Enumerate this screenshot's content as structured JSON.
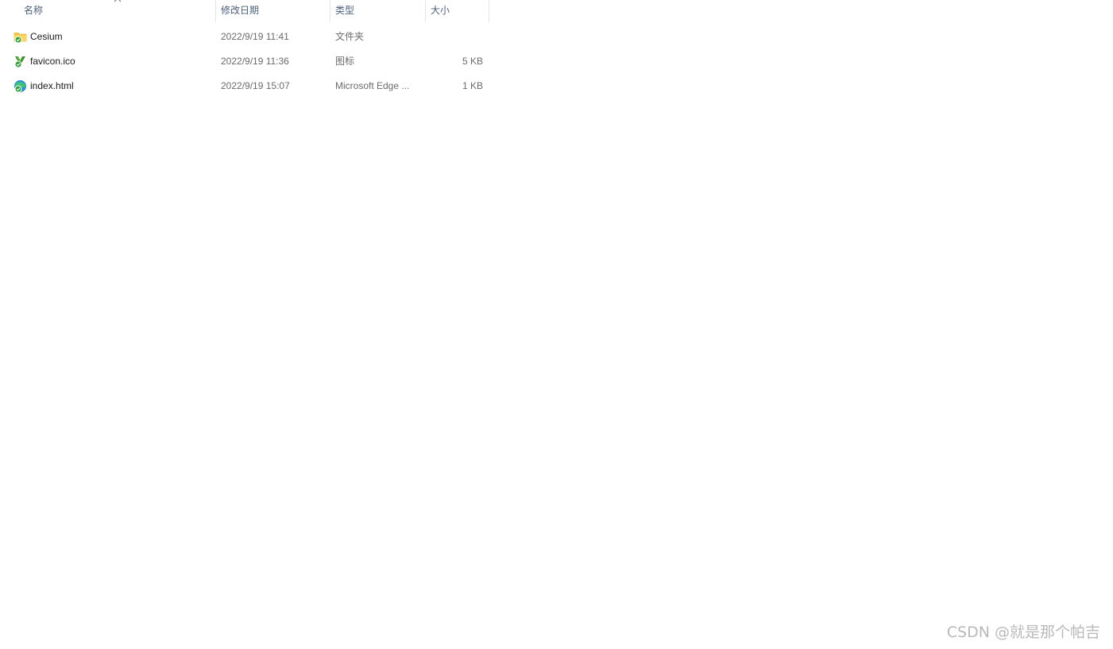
{
  "columns": {
    "name": "名称",
    "date": "修改日期",
    "type": "类型",
    "size": "大小"
  },
  "sort": {
    "column": "name",
    "icon": "chevron-up-icon"
  },
  "files": [
    {
      "name": "Cesium",
      "date": "2022/9/19 11:41",
      "type": "文件夹",
      "size": "",
      "icon": "folder-synced-icon"
    },
    {
      "name": "favicon.ico",
      "date": "2022/9/19 11:36",
      "type": "图标",
      "size": "5 KB",
      "icon": "cesium-favicon-icon"
    },
    {
      "name": "index.html",
      "date": "2022/9/19 15:07",
      "type": "Microsoft Edge ...",
      "size": "1 KB",
      "icon": "edge-html-icon"
    }
  ],
  "watermark": "CSDN @就是那个帕吉",
  "colors": {
    "header_text": "#4c607a",
    "detail_text": "#6b6b6b",
    "folder": "#f5c43b",
    "sync_badge": "#2e9e3a"
  }
}
